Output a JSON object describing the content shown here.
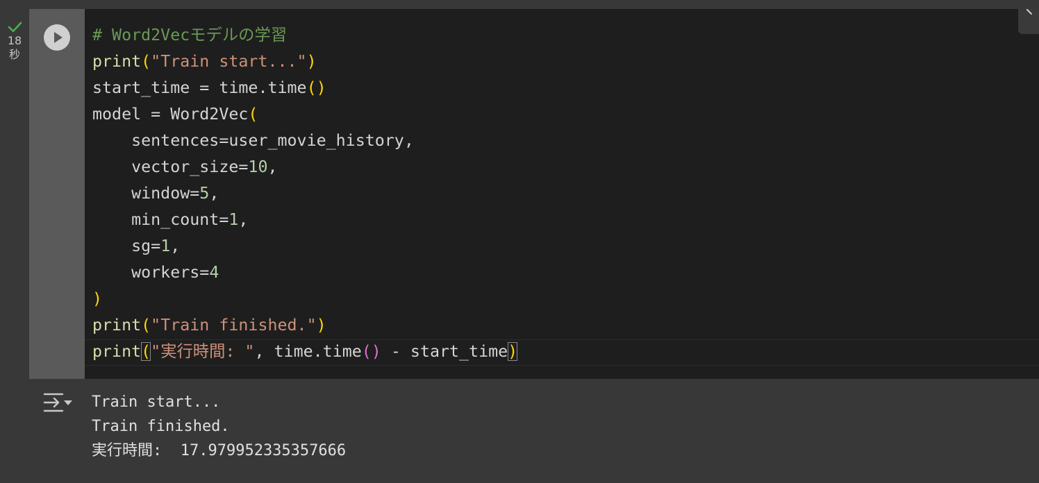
{
  "cell": {
    "status": {
      "icon": "check-icon",
      "seconds": "18",
      "unit": "秒"
    },
    "run_button": {
      "icon": "play-icon"
    },
    "code_lines": [
      [
        {
          "t": "# Word2Vecモデルの学習",
          "c": "cmt"
        }
      ],
      [
        {
          "t": "print",
          "c": "kw"
        },
        {
          "t": "(",
          "c": "paren"
        },
        {
          "t": "\"Train start...\"",
          "c": "str"
        },
        {
          "t": ")",
          "c": "paren"
        }
      ],
      [
        {
          "t": "start_time = time.time",
          "c": "txt"
        },
        {
          "t": "()",
          "c": "paren"
        }
      ],
      [
        {
          "t": "model = Word2Vec",
          "c": "txt"
        },
        {
          "t": "(",
          "c": "paren"
        }
      ],
      [
        {
          "t": "    sentences=user_movie_history,",
          "c": "txt"
        }
      ],
      [
        {
          "t": "    vector_size=",
          "c": "txt"
        },
        {
          "t": "10",
          "c": "num"
        },
        {
          "t": ",",
          "c": "txt"
        }
      ],
      [
        {
          "t": "    window=",
          "c": "txt"
        },
        {
          "t": "5",
          "c": "num"
        },
        {
          "t": ",",
          "c": "txt"
        }
      ],
      [
        {
          "t": "    min_count=",
          "c": "txt"
        },
        {
          "t": "1",
          "c": "num"
        },
        {
          "t": ",",
          "c": "txt"
        }
      ],
      [
        {
          "t": "    sg=",
          "c": "txt"
        },
        {
          "t": "1",
          "c": "num"
        },
        {
          "t": ",",
          "c": "txt"
        }
      ],
      [
        {
          "t": "    workers=",
          "c": "txt"
        },
        {
          "t": "4",
          "c": "num"
        }
      ],
      [
        {
          "t": ")",
          "c": "paren"
        }
      ],
      [
        {
          "t": "print",
          "c": "kw"
        },
        {
          "t": "(",
          "c": "paren"
        },
        {
          "t": "\"Train finished.\"",
          "c": "str"
        },
        {
          "t": ")",
          "c": "paren"
        }
      ],
      [
        {
          "t": "print",
          "c": "kw"
        },
        {
          "t": "(",
          "c": "paren bracket-match"
        },
        {
          "t": "\"実行時間: \"",
          "c": "str"
        },
        {
          "t": ", time.time",
          "c": "txt"
        },
        {
          "t": "()",
          "c": "paren2"
        },
        {
          "t": " - start_time",
          "c": "txt"
        },
        {
          "t": ")",
          "c": "paren bracket-match"
        }
      ]
    ]
  },
  "output": {
    "toggle_icon": "output-collapse-icon",
    "lines": [
      "Train start...",
      "Train finished.",
      "実行時間:  17.979952335357666"
    ]
  },
  "colors": {
    "comment": "#6a9955",
    "keyword": "#dcdcaa",
    "string": "#ce9178",
    "number": "#b5cea8",
    "bracket": "#ffd700",
    "bracket_inner": "#da70d6",
    "check": "#4caf50"
  }
}
